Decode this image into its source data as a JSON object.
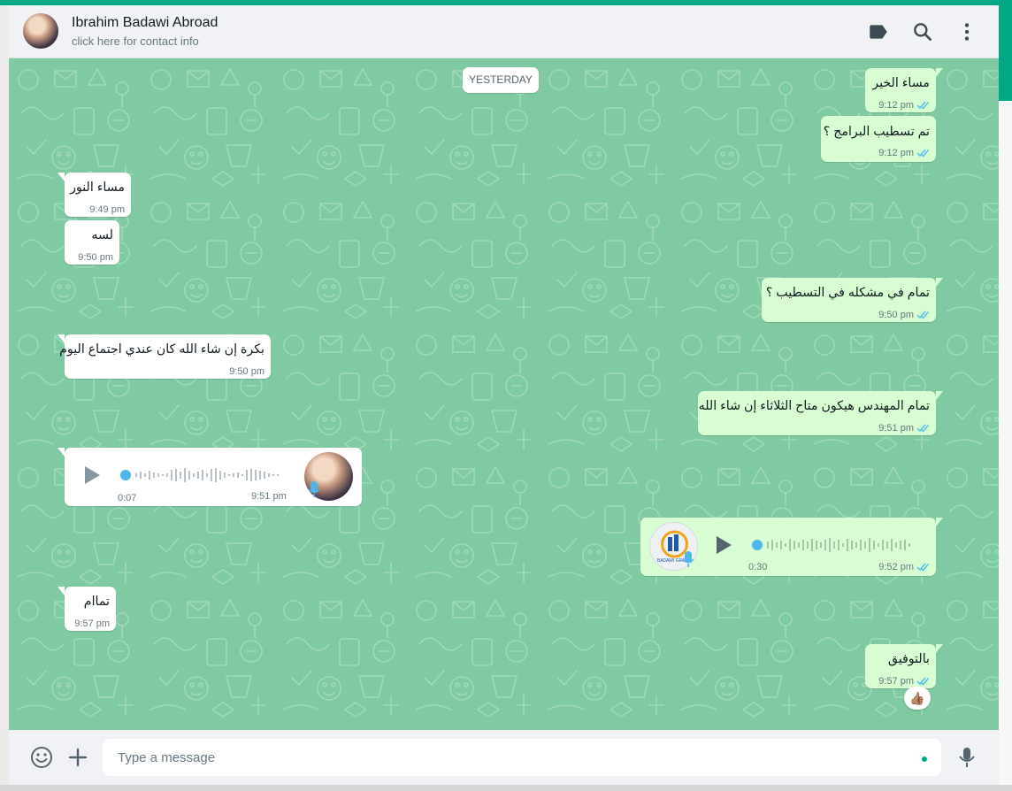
{
  "contact": {
    "name": "Ibrahim Badawi Abroad",
    "subtitle": "click here for contact info"
  },
  "header_icons": [
    "label-icon",
    "search-icon",
    "menu-dots-icon"
  ],
  "day_separator": "YESTERDAY",
  "messages": [
    {
      "dir": "out",
      "text": "مساء الخير",
      "time": "9:12 pm",
      "ticks": "read"
    },
    {
      "dir": "out",
      "text": "تم تسطيب البرامج ؟",
      "time": "9:12 pm",
      "ticks": "read"
    },
    {
      "dir": "in",
      "text": "مساء النور",
      "time": "9:49 pm"
    },
    {
      "dir": "in",
      "text": "لسه",
      "time": "9:50 pm"
    },
    {
      "dir": "out",
      "text": "تمام في مشكله في التسطيب ؟",
      "time": "9:50 pm",
      "ticks": "read"
    },
    {
      "dir": "in",
      "text": "بكرة إن شاء الله كان عندي اجتماع اليوم",
      "time": "9:50 pm"
    },
    {
      "dir": "out",
      "text": "تمام المهندس هيكون متاح الثلاثاء إن شاء الله",
      "time": "9:51 pm",
      "ticks": "read"
    },
    {
      "dir": "in",
      "text": "تماام",
      "time": "9:57 pm"
    },
    {
      "dir": "out",
      "text": "بالتوفيق",
      "time": "9:57 pm",
      "ticks": "read",
      "reaction": "👍🏽"
    }
  ],
  "voice_notes": [
    {
      "dir": "in",
      "duration": "0:07",
      "time": "9:51 pm",
      "progress": 0
    },
    {
      "dir": "out",
      "duration": "0:30",
      "time": "9:52 pm",
      "ticks": "read",
      "progress": 0,
      "avatar_logo_text": "BADAWI GROUP"
    }
  ],
  "composer": {
    "placeholder": "Type a message"
  },
  "colors": {
    "accent": "#00a884",
    "wallpaper": "#7fcaa2",
    "outgoing": "#d9fdd3",
    "incoming": "#ffffff",
    "tick_read": "#53bdeb"
  }
}
